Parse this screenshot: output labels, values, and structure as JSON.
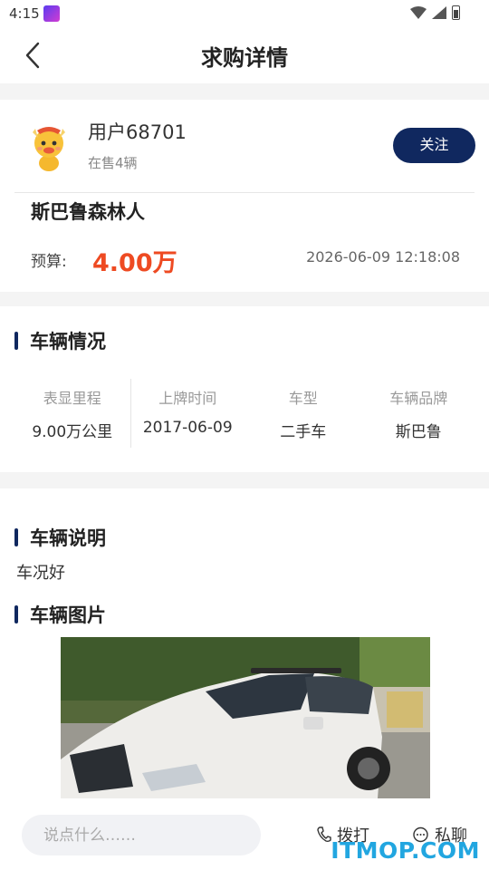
{
  "status_bar": {
    "time": "4:15"
  },
  "header": {
    "title": "求购详情"
  },
  "user": {
    "name": "用户68701",
    "sub": "在售4辆",
    "follow_label": "关注"
  },
  "listing": {
    "car_name": "斯巴鲁森林人",
    "budget_label": "预算:",
    "budget_value": "4.00万",
    "datetime": "2026-06-09 12:18:08"
  },
  "vehicle_section": {
    "title": "车辆情况",
    "stats": [
      {
        "label": "表显里程",
        "value": "9.00万公里"
      },
      {
        "label": "上牌时间",
        "value": "2017-06-09"
      },
      {
        "label": "车型",
        "value": "二手车"
      },
      {
        "label": "车辆品牌",
        "value": "斯巴鲁"
      }
    ]
  },
  "description_section": {
    "title": "车辆说明",
    "text": "车况好"
  },
  "images_section": {
    "title": "车辆图片"
  },
  "bottom_bar": {
    "input_placeholder": "说点什么……",
    "call_label": "拨打",
    "chat_label": "私聊",
    "watermark": "ITMOP.COM"
  },
  "colors": {
    "accent": "#10285f",
    "price": "#ee4a22",
    "watermark": "#22a6e0"
  }
}
